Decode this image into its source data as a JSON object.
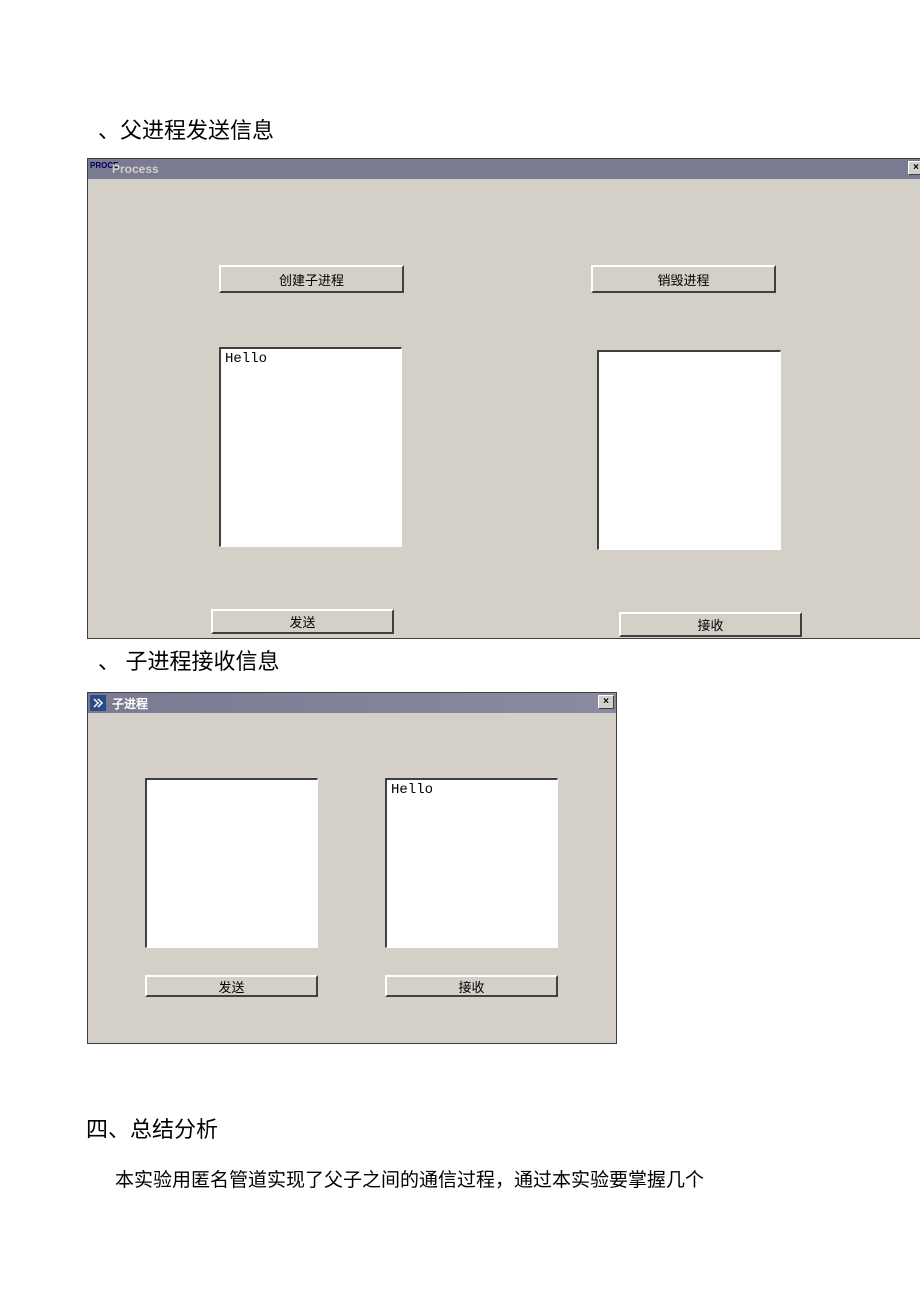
{
  "doc": {
    "caption_parent": "、父进程发送信息",
    "caption_child": "、 子进程接收信息",
    "section_heading": "四、总结分析",
    "body_text": "本实验用匿名管道实现了父子之间的通信过程，通过本实验要掌握几个"
  },
  "parent_window": {
    "icon_label": "PROCE",
    "title": "Process",
    "close_label": "×",
    "buttons": {
      "create_child": "创建子进程",
      "destroy": "销毁进程",
      "send": "发送",
      "receive": "接收"
    },
    "textboxes": {
      "send_value": "Hello",
      "receive_value": ""
    }
  },
  "child_window": {
    "title": "子进程",
    "close_label": "×",
    "buttons": {
      "send": "发送",
      "receive": "接收"
    },
    "textboxes": {
      "send_value": "",
      "receive_value": "Hello"
    }
  }
}
